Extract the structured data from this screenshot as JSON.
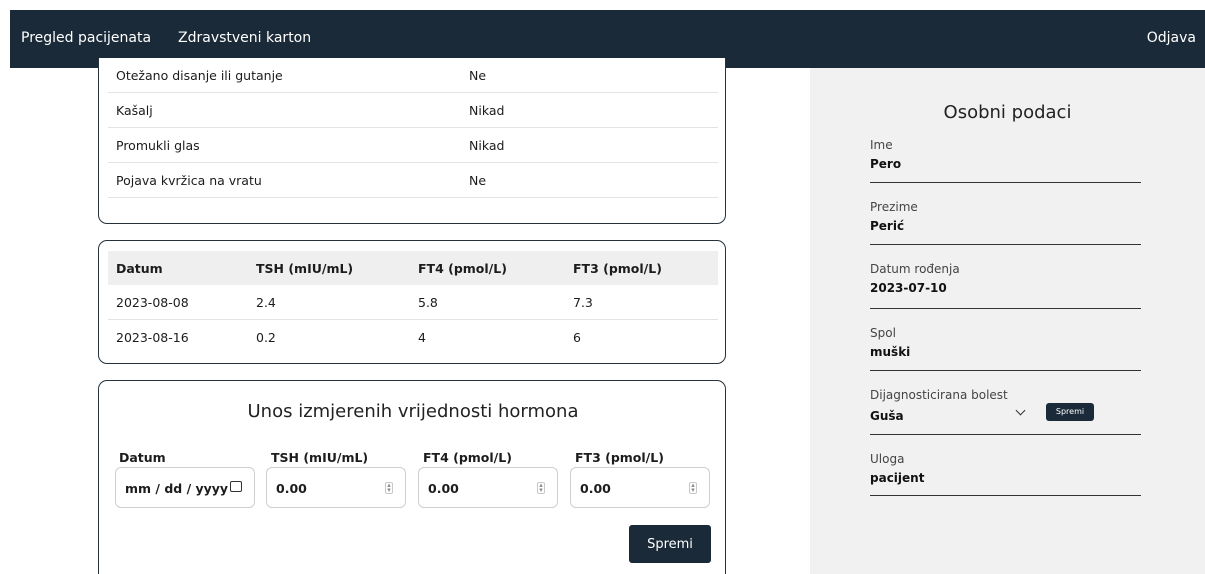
{
  "nav": {
    "links": [
      "Pregled pacijenata",
      "Zdravstveni karton"
    ],
    "logout": "Odjava"
  },
  "symptoms": [
    {
      "label": "Otežano disanje ili gutanje",
      "value": "Ne"
    },
    {
      "label": "Kašalj",
      "value": "Nikad"
    },
    {
      "label": "Promukli glas",
      "value": "Nikad"
    },
    {
      "label": "Pojava kvržica na vratu",
      "value": "Ne"
    }
  ],
  "hormone_table": {
    "headers": [
      "Datum",
      "TSH (mIU/mL)",
      "FT4 (pmol/L)",
      "FT3 (pmol/L)"
    ],
    "rows": [
      [
        "2023-08-08",
        "2.4",
        "5.8",
        "7.3"
      ],
      [
        "2023-08-16",
        "0.2",
        "4",
        "6"
      ]
    ]
  },
  "entry_form": {
    "title": "Unos izmjerenih vrijednosti hormona",
    "date_label": "Datum",
    "date_placeholder": "mm / dd / yyyy",
    "tsh_label": "TSH (mIU/mL)",
    "tsh_value": "0.00",
    "ft4_label": "FT4 (pmol/L)",
    "ft4_value": "0.00",
    "ft3_label": "FT3 (pmol/L)",
    "ft3_value": "0.00",
    "save_label": "Spremi"
  },
  "personal": {
    "title": "Osobni podaci",
    "fields": [
      {
        "label": "Ime",
        "value": "Pero"
      },
      {
        "label": "Prezime",
        "value": "Perić"
      },
      {
        "label": "Datum rođenja",
        "value": "2023-07-10"
      },
      {
        "label": "Spol",
        "value": "muški"
      }
    ],
    "disease_label": "Dijagnosticirana bolest",
    "disease_value": "Guša",
    "disease_save": "Spremi",
    "role_label": "Uloga",
    "role_value": "pacijent"
  }
}
